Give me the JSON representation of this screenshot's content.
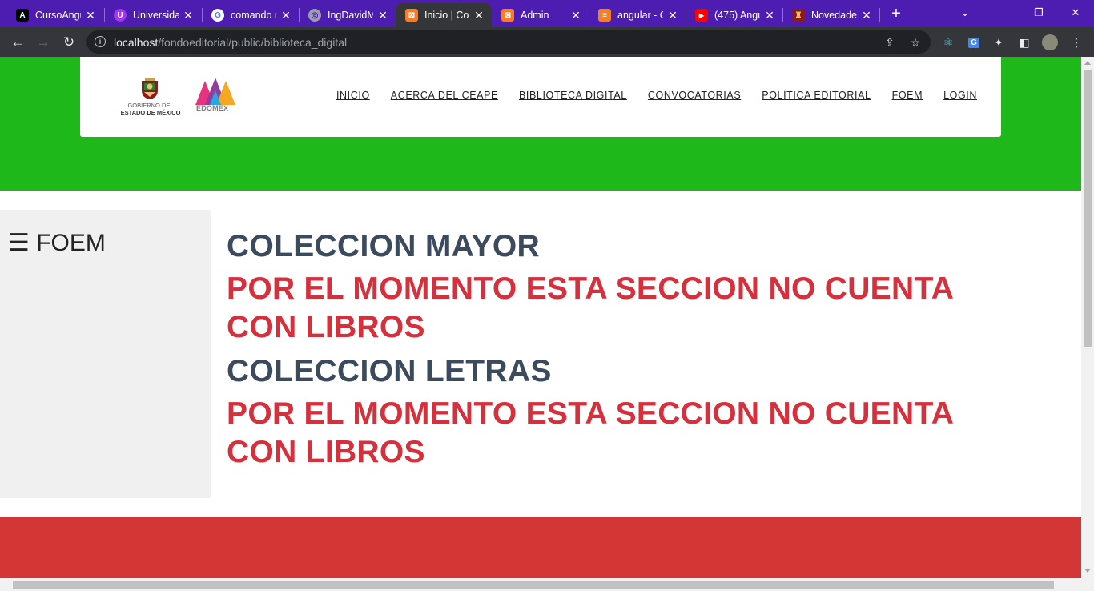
{
  "browser": {
    "tabs": [
      {
        "title": "CursoAngu",
        "favicon": "angular-icon",
        "color": "#000000",
        "glyph": "A"
      },
      {
        "title": "Universida",
        "favicon": "udemy-icon",
        "color": "#a435f0",
        "glyph": "U"
      },
      {
        "title": "comando n",
        "favicon": "google-icon",
        "color": "#ffffff",
        "glyph": "G"
      },
      {
        "title": "IngDavidM",
        "favicon": "globe-icon",
        "color": "#9aa0a6",
        "glyph": "◎"
      },
      {
        "title": "Inicio | Con",
        "favicon": "xampp-icon",
        "color": "#fb7a24",
        "glyph": "⊠"
      },
      {
        "title": "Admin",
        "favicon": "xampp-icon",
        "color": "#fb7a24",
        "glyph": "⊠"
      },
      {
        "title": "angular - C",
        "favicon": "stackoverflow-icon",
        "color": "#f48024",
        "glyph": "≡"
      },
      {
        "title": "(475) Angu",
        "favicon": "youtube-icon",
        "color": "#ff0000",
        "glyph": "▶"
      },
      {
        "title": "Novedade",
        "favicon": "edomex-icon",
        "color": "#8b1a1a",
        "glyph": "♜"
      }
    ],
    "url_host": "localhost",
    "url_path": "/fondoeditorial/public/biblioteca_digital"
  },
  "site": {
    "logo_gob_line1": "GOBIERNO DEL",
    "logo_gob_line2": "ESTADO DE MÉXICO",
    "logo_edomex": "EDOMEX",
    "nav": [
      "INICIO",
      "ACERCA DEL CEAPE",
      "BIBLIOTECA DIGITAL",
      "CONVOCATORIAS",
      "POLÍTICA EDITORIAL",
      "FOEM",
      "LOGIN"
    ],
    "sidebar_title": "☰ FOEM",
    "sections": [
      {
        "heading": "COLECCION MAYOR",
        "message": "POR EL MOMENTO ESTA SECCION NO CUENTA CON LIBROS"
      },
      {
        "heading": "COLECCION LETRAS",
        "message": "POR EL MOMENTO ESTA SECCION NO CUENTA CON LIBROS"
      }
    ]
  },
  "colors": {
    "tabbar": "#4c1db0",
    "green_band": "#1fb81b",
    "red_band": "#d43535",
    "heading": "#3b4a5c",
    "message": "#d6303d"
  }
}
